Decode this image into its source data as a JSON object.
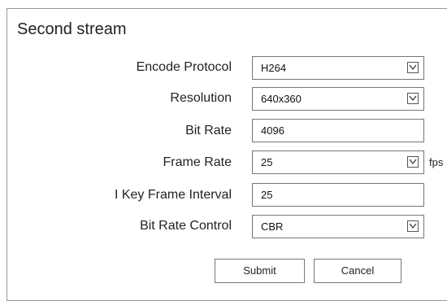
{
  "title": "Second stream",
  "fields": {
    "encode_protocol": {
      "label": "Encode Protocol",
      "value": "H264"
    },
    "resolution": {
      "label": "Resolution",
      "value": "640x360"
    },
    "bit_rate": {
      "label": "Bit Rate",
      "value": "4096"
    },
    "frame_rate": {
      "label": "Frame Rate",
      "value": "25",
      "unit": "fps"
    },
    "i_key_frame_interval": {
      "label": "I Key Frame Interval",
      "value": "25"
    },
    "bit_rate_control": {
      "label": "Bit Rate Control",
      "value": "CBR"
    }
  },
  "buttons": {
    "submit": "Submit",
    "cancel": "Cancel"
  },
  "icons": {
    "dropdown": "chevron-down-icon"
  }
}
